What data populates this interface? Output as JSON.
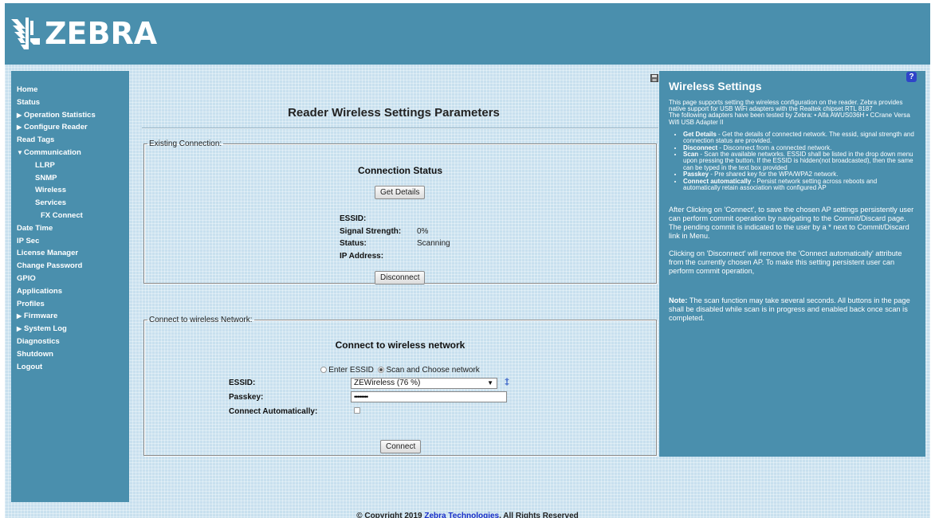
{
  "brand": {
    "logo_text": "ZEBRA"
  },
  "sidebar": {
    "items": [
      {
        "label": "Home"
      },
      {
        "label": "Status"
      },
      {
        "label": "Operation Statistics"
      },
      {
        "label": "Configure Reader"
      },
      {
        "label": "Read Tags"
      },
      {
        "label": "Communication"
      },
      {
        "label": "LLRP"
      },
      {
        "label": "SNMP"
      },
      {
        "label": "Wireless"
      },
      {
        "label": "Services"
      },
      {
        "label": "FX Connect"
      },
      {
        "label": "Date Time"
      },
      {
        "label": "IP Sec"
      },
      {
        "label": "License Manager"
      },
      {
        "label": "Change Password"
      },
      {
        "label": "GPIO"
      },
      {
        "label": "Applications"
      },
      {
        "label": "Profiles"
      },
      {
        "label": "Firmware"
      },
      {
        "label": "System Log"
      },
      {
        "label": "Diagnostics"
      },
      {
        "label": "Shutdown"
      },
      {
        "label": "Logout"
      }
    ]
  },
  "main": {
    "title": "Reader Wireless Settings Parameters",
    "existing": {
      "legend": "Existing Connection:",
      "heading": "Connection Status",
      "get_details_label": "Get Details",
      "essid_label": "ESSID:",
      "essid_value": "",
      "signal_label": "Signal Strength:",
      "signal_value": "0%",
      "status_label": "Status:",
      "status_value": "Scanning",
      "ip_label": "IP Address:",
      "ip_value": "",
      "disconnect_label": "Disconnect"
    },
    "connect": {
      "legend": "Connect to wireless Network:",
      "heading": "Connect to wireless network",
      "radio_enter_label": "Enter ESSID",
      "radio_scan_label": "Scan and Choose network",
      "essid_label": "ESSID:",
      "essid_selected": "ZEWireless (76 %)",
      "passkey_label": "Passkey:",
      "passkey_value": "••••••••",
      "auto_label": "Connect Automatically:",
      "connect_label": "Connect"
    }
  },
  "help": {
    "title": "Wireless Settings",
    "badge": "?",
    "intro": "This page supports setting the wireless configuration on the reader. Zebra provides native support for USB WiFi adapters with the Realtek chipset RTL 8187",
    "adapters": "The following adapters have been tested by Zebra: • Alfa AWUS036H • CCrane Versa Wifi USB Adapter II",
    "bullets": [
      {
        "term": "Get Details",
        "text": " - Get the details of connected network. The essid, signal strength and connection status are provided."
      },
      {
        "term": "Disconnect",
        "text": " - Disconnect from a connected network."
      },
      {
        "term": "Scan",
        "text": " - Scan the available networks. ESSID shall be listed in the drop down menu upon pressing the button. If the ESSID is hidden(not broadcasted), then the same can be typed in the text box provided"
      },
      {
        "term": "Passkey",
        "text": " - Pre shared key for the WPA/WPA2 network."
      },
      {
        "term": "Connect automatically",
        "text": " - Persist network setting across reboots and automatically retain association with configured AP"
      }
    ],
    "para_commit": "After Clicking on 'Connect', to save the chosen AP settings persistently user can perform commit operation by navigating to the Commit/Discard page. The pending commit is indicated to the user by a * next to Commit/Discard link in Menu.",
    "para_disconnect": "Clicking on 'Disconnect' will remove the 'Connect automatically' attribute from the currently chosen AP. To make this setting persistent user can perform commit operation,",
    "note_label": "Note:",
    "note_text": " The scan function may take several seconds. All buttons in the page shall be disabled while scan is in progress and enabled back once scan is completed."
  },
  "footer": {
    "prefix": "© Copyright 2019 ",
    "link": "Zebra Technologies",
    "suffix": ". All Rights Reserved"
  }
}
